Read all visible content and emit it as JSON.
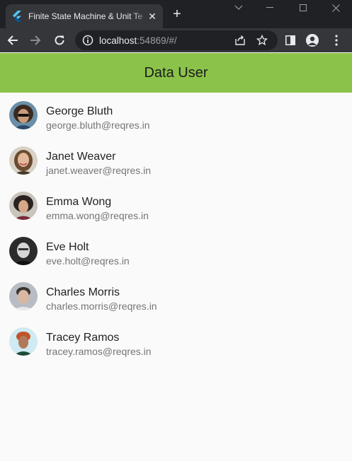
{
  "browser": {
    "tab_title": "Finite State Machine & Unit Te",
    "url_host": "localhost",
    "url_rest": ":54869/#/"
  },
  "app": {
    "title": "Data User"
  },
  "users": [
    {
      "name": "George Bluth",
      "email": "george.bluth@reqres.in"
    },
    {
      "name": "Janet Weaver",
      "email": "janet.weaver@reqres.in"
    },
    {
      "name": "Emma Wong",
      "email": "emma.wong@reqres.in"
    },
    {
      "name": "Eve Holt",
      "email": "eve.holt@reqres.in"
    },
    {
      "name": "Charles Morris",
      "email": "charles.morris@reqres.in"
    },
    {
      "name": "Tracey Ramos",
      "email": "tracey.ramos@reqres.in"
    }
  ],
  "colors": {
    "appbar": "#8bc34a",
    "background": "#fafafa",
    "chrome_dark": "#202124",
    "chrome_toolbar": "#35363a"
  }
}
